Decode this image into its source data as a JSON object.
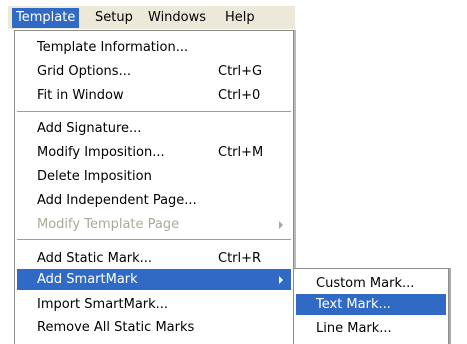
{
  "menubar": {
    "items": [
      {
        "label": "Template"
      },
      {
        "label": "Setup"
      },
      {
        "label": "Windows"
      },
      {
        "label": "Help"
      }
    ]
  },
  "template_menu": {
    "items": [
      {
        "label": "Template Information...",
        "shortcut": ""
      },
      {
        "label": "Grid Options...",
        "shortcut": "Ctrl+G"
      },
      {
        "label": "Fit in Window",
        "shortcut": "Ctrl+0"
      },
      {
        "label": "Add Signature...",
        "shortcut": ""
      },
      {
        "label": "Modify Imposition...",
        "shortcut": "Ctrl+M"
      },
      {
        "label": "Delete Imposition",
        "shortcut": ""
      },
      {
        "label": "Add Independent Page...",
        "shortcut": ""
      },
      {
        "label": "Modify Template Page",
        "shortcut": ""
      },
      {
        "label": "Add Static Mark...",
        "shortcut": "Ctrl+R"
      },
      {
        "label": "Add SmartMark",
        "shortcut": ""
      },
      {
        "label": "Import SmartMark...",
        "shortcut": ""
      },
      {
        "label": "Remove All Static Marks",
        "shortcut": ""
      }
    ]
  },
  "smartmark_submenu": {
    "items": [
      {
        "label": "Custom Mark..."
      },
      {
        "label": "Text Mark..."
      },
      {
        "label": "Line Mark..."
      }
    ]
  },
  "colors": {
    "highlight": "#316ac5",
    "menubar_bg": "#ece9d8",
    "disabled_text": "#aca899"
  }
}
